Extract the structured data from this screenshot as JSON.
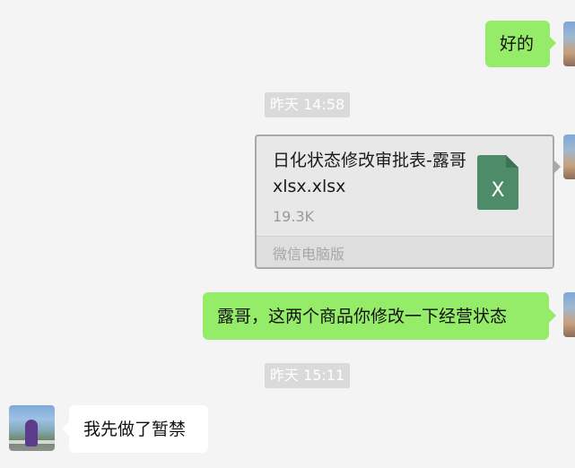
{
  "messages": {
    "m1_text": "好的",
    "ts1": "昨天 14:58",
    "file": {
      "name": "日化状态修改审批表-露哥xlsx.xlsx",
      "size": "19.3K",
      "source": "微信电脑版",
      "icon_letter": "X",
      "icon_color": "#4d8b69"
    },
    "m3_text": "露哥，这两个商品你修改一下经营状态",
    "ts2": "昨天 15:11",
    "m4_text": "我先做了暂禁"
  },
  "colors": {
    "background": "#f4f4f4",
    "outgoing_bubble": "#95ec69",
    "incoming_bubble": "#ffffff",
    "timestamp_bg": "#dadada"
  }
}
